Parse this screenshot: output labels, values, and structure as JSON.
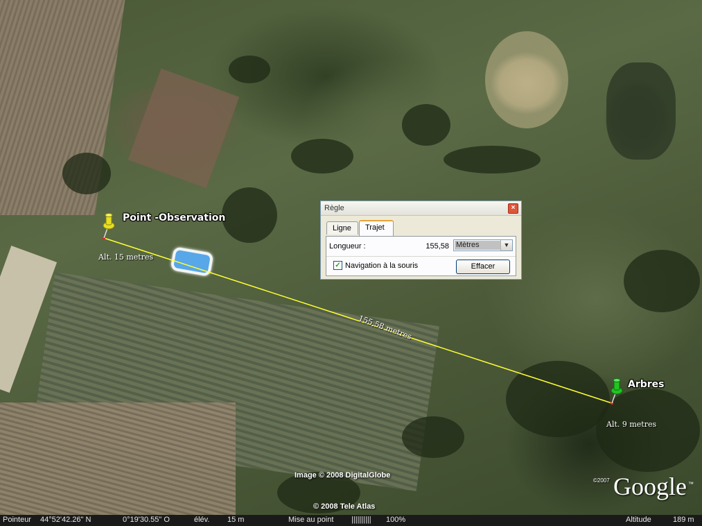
{
  "placemarks": {
    "observation": {
      "name": "Point -Observation",
      "altitude": "Alt. 15 metres",
      "color": "#e8e020"
    },
    "trees": {
      "name": "Arbres",
      "altitude": "Alt. 9 metres",
      "color": "#22c422"
    }
  },
  "measure_line": {
    "label": "155,58 metres",
    "color": "#ffff33"
  },
  "ruler": {
    "title": "Règle",
    "close_icon": "×",
    "tabs": [
      "Ligne",
      "Trajet"
    ],
    "active_tab": "Trajet",
    "length_label": "Longueur :",
    "length_value": "155,58",
    "unit": "Mètres",
    "mouse_nav_label": "Navigation à la souris",
    "mouse_nav_checked": true,
    "clear_button": "Effacer"
  },
  "credits": {
    "imagery": "Image © 2008 DigitalGlobe",
    "data": "© 2008 Tele Atlas",
    "logo": "Google",
    "logo_year": "©2007",
    "trademark": "™"
  },
  "status": {
    "pointer_label": "Pointeur",
    "lat": "44°52'42.26\" N",
    "lon": "0°19'30.55\" O",
    "elev_label": "élév.",
    "elev_value": "15 m",
    "focus_label": "Mise au point",
    "focus_bars": "||||||||||",
    "focus_pct": "100%",
    "altitude_label": "Altitude",
    "altitude_value": "189 m"
  }
}
